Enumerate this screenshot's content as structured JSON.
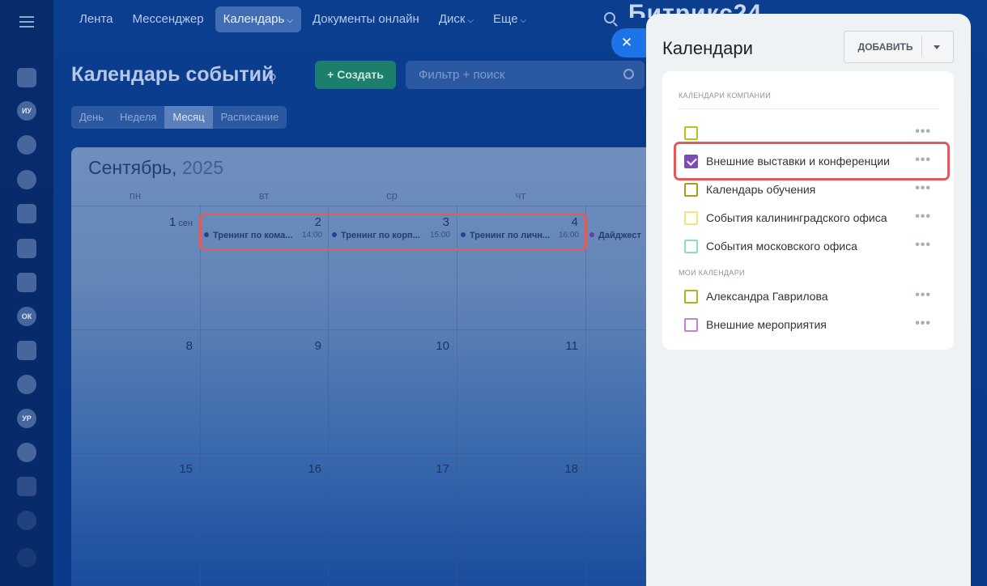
{
  "topnav": {
    "items": [
      {
        "label": "Лента"
      },
      {
        "label": "Мессенджер"
      },
      {
        "label": "Календарь"
      },
      {
        "label": "Документы онлайн"
      },
      {
        "label": "Диск"
      },
      {
        "label": "Еще"
      }
    ],
    "logo": "Битрикс24"
  },
  "sidebar_badges": {
    "iu": "ИУ",
    "ok": "ОК",
    "ur": "УР"
  },
  "header": {
    "title": "Календарь событий",
    "create_label": "Создать",
    "filter_placeholder": "Фильтр + поиск"
  },
  "view_tabs": [
    "День",
    "Неделя",
    "Месяц",
    "Расписание"
  ],
  "calendar": {
    "month": "Сентябрь,",
    "year": "2025",
    "weekdays": [
      "пн",
      "вт",
      "ср",
      "чт"
    ],
    "days": [
      {
        "num": "1",
        "suffix": "сен"
      },
      {
        "num": "2"
      },
      {
        "num": "3"
      },
      {
        "num": "4"
      },
      {
        "num": "8"
      },
      {
        "num": "9"
      },
      {
        "num": "10"
      },
      {
        "num": "11"
      },
      {
        "num": "15"
      },
      {
        "num": "16"
      },
      {
        "num": "17"
      },
      {
        "num": "18"
      }
    ],
    "events": [
      {
        "title": "Тренинг по кома...",
        "time": "14:00"
      },
      {
        "title": "Тренинг по корп...",
        "time": "15:00"
      },
      {
        "title": "Тренинг по личн...",
        "time": "16:00"
      },
      {
        "title": "Дайджест"
      }
    ]
  },
  "panel": {
    "title": "Календари",
    "add_label": "ДОБАВИТЬ",
    "company_header": "КАЛЕНДАРИ КОМПАНИИ",
    "my_header": "МОИ КАЛЕНДАРИ",
    "company_calendars": [
      {
        "name": "",
        "color": "#b5c51c",
        "checked": false
      },
      {
        "name": "Внешние выставки и конференции",
        "color": "#7f4ab8",
        "checked": true
      },
      {
        "name": "Календарь обучения",
        "color": "#a39f20",
        "checked": false
      },
      {
        "name": "События калининградского офиса",
        "color": "#f4e27a",
        "checked": false
      },
      {
        "name": "События московского офиса",
        "color": "#8fdcc5",
        "checked": false
      }
    ],
    "my_calendars": [
      {
        "name": "Александра Гаврилова",
        "color": "#a4b820",
        "checked": false
      },
      {
        "name": "Внешние мероприятия",
        "color": "#c47fd9",
        "checked": false
      }
    ]
  }
}
